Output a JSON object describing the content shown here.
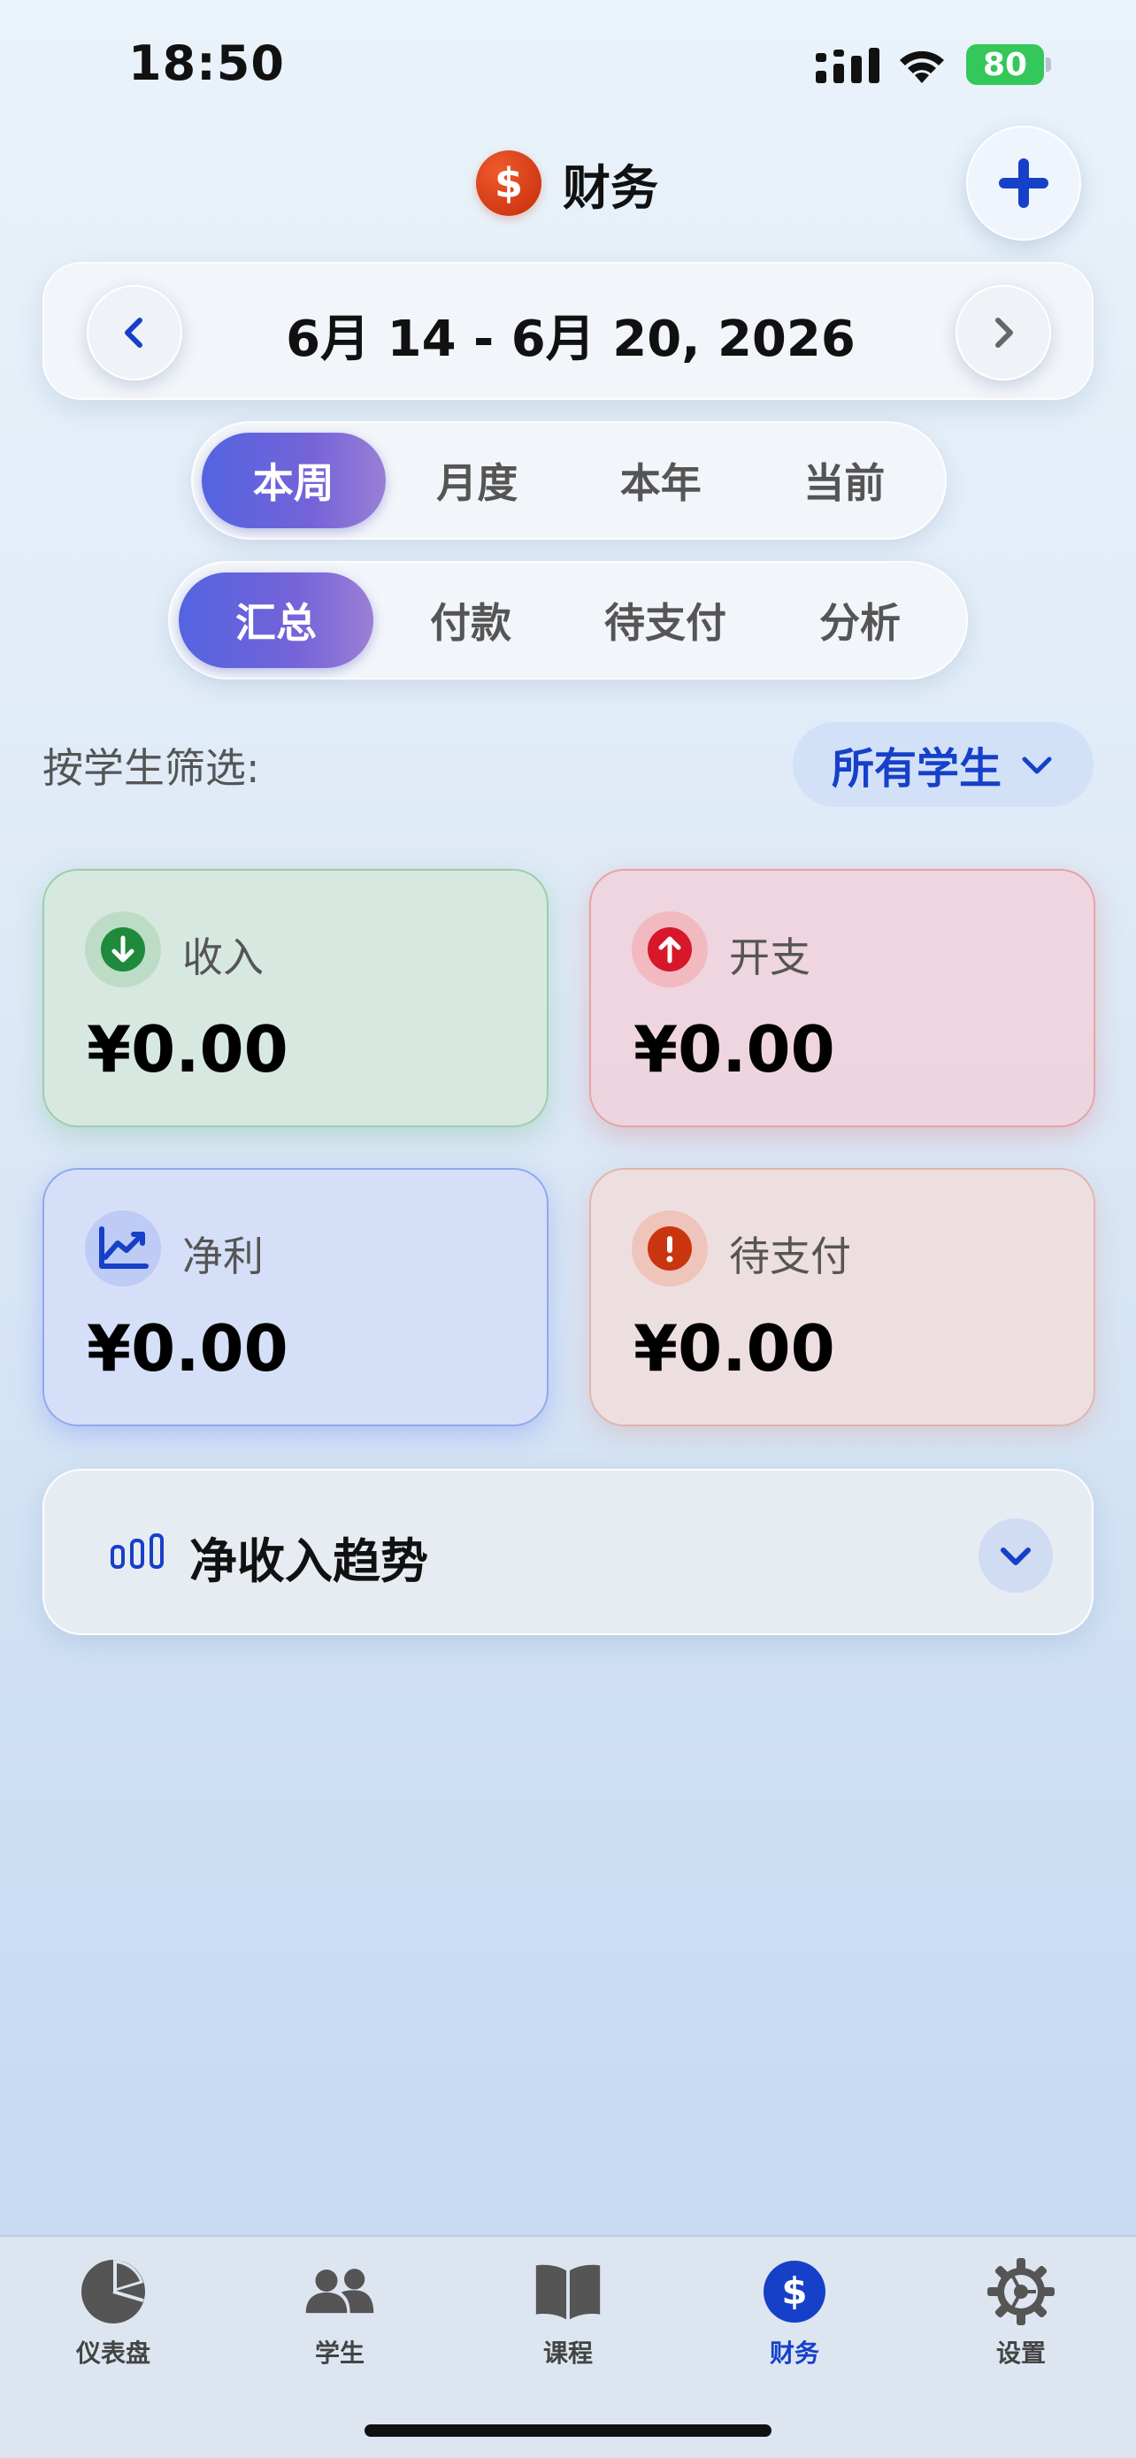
{
  "status_bar": {
    "time": "18:50",
    "battery": "80"
  },
  "header": {
    "title": "财务",
    "title_icon": "dollar-icon",
    "add_icon": "plus-icon"
  },
  "date_nav": {
    "range": "6月 14 - 6月 20, 2026"
  },
  "period_tabs": [
    {
      "label": "本周",
      "active": true
    },
    {
      "label": "月度",
      "active": false
    },
    {
      "label": "本年",
      "active": false
    },
    {
      "label": "当前",
      "active": false
    }
  ],
  "view_tabs": [
    {
      "label": "汇总",
      "active": true
    },
    {
      "label": "付款",
      "active": false
    },
    {
      "label": "待支付",
      "active": false
    },
    {
      "label": "分析",
      "active": false
    }
  ],
  "filter": {
    "label": "按学生筛选:",
    "value": "所有学生"
  },
  "stats": {
    "income": {
      "label": "收入",
      "value": "¥0.00",
      "color": "#1f8a3b"
    },
    "expense": {
      "label": "开支",
      "value": "¥0.00",
      "color": "#d7172a"
    },
    "net": {
      "label": "净利",
      "value": "¥0.00",
      "color": "#1740c8"
    },
    "pending": {
      "label": "待支付",
      "value": "¥0.00",
      "color": "#c8350f"
    }
  },
  "trend": {
    "label": "净收入趋势"
  },
  "tabbar": [
    {
      "label": "仪表盘",
      "icon": "pie-chart-icon",
      "active": false
    },
    {
      "label": "学生",
      "icon": "people-icon",
      "active": false
    },
    {
      "label": "课程",
      "icon": "book-icon",
      "active": false
    },
    {
      "label": "财务",
      "icon": "dollar-icon",
      "active": true
    },
    {
      "label": "设置",
      "icon": "gear-icon",
      "active": false
    }
  ],
  "colors": {
    "accent": "#1740c8",
    "segment_active_start": "#5364e0",
    "segment_active_end": "#9a7fd6"
  }
}
